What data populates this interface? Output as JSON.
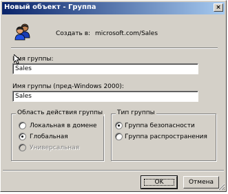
{
  "window": {
    "title": "Новый объект - Группа",
    "close_glyph": "×"
  },
  "header": {
    "icon": "group-users-icon",
    "create_in_label": "Создать в:",
    "create_in_value": "microsoft.com/Sales"
  },
  "form": {
    "group_name_label": "Имя группы:",
    "group_name_value": "Sales",
    "group_name_pre2000_label": "Имя группы (пред-Windows 2000):",
    "group_name_pre2000_value": "Sales"
  },
  "scope": {
    "caption": "Область действия группы",
    "options": [
      {
        "label": "Локальная в домене",
        "selected": false,
        "enabled": true
      },
      {
        "label": "Глобальная",
        "selected": true,
        "enabled": true
      },
      {
        "label": "Универсальная",
        "selected": false,
        "enabled": false
      }
    ]
  },
  "type": {
    "caption": "Тип группы",
    "options": [
      {
        "label": "Группа безопасности",
        "selected": true,
        "enabled": true
      },
      {
        "label": "Группа распространения",
        "selected": false,
        "enabled": true
      }
    ]
  },
  "buttons": {
    "ok_label": "OK",
    "cancel_label": "Отмена"
  },
  "colors": {
    "title_gradient_start": "#0a246a",
    "title_gradient_end": "#a6caf0",
    "face": "#d4d0c8"
  }
}
